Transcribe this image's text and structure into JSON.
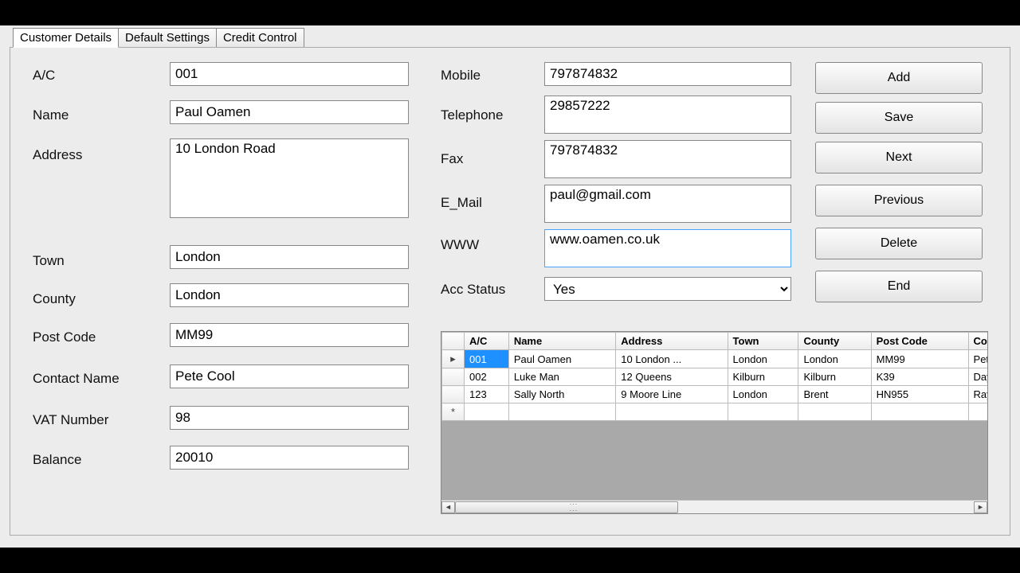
{
  "tabs": {
    "customer_details": "Customer Details",
    "default_settings": "Default Settings",
    "credit_control": "Credit Control"
  },
  "labels": {
    "ac": "A/C",
    "name": "Name",
    "address": "Address",
    "town": "Town",
    "county": "County",
    "post_code": "Post Code",
    "contact_name": "Contact Name",
    "vat_number": "VAT Number",
    "balance": "Balance",
    "mobile": "Mobile",
    "telephone": "Telephone",
    "fax": "Fax",
    "email": "E_Mail",
    "www": "WWW",
    "acc_status": "Acc Status"
  },
  "values": {
    "ac": "001",
    "name": "Paul Oamen",
    "address": "10 London Road",
    "town": "London",
    "county": "London",
    "post_code": "MM99",
    "contact_name": "Pete Cool",
    "vat_number": "98",
    "balance": "20010",
    "mobile": "797874832",
    "telephone": "29857222",
    "fax": "797874832",
    "email": "paul@gmail.com",
    "www": "www.oamen.co.uk",
    "acc_status": "Yes"
  },
  "buttons": {
    "add": "Add",
    "save": "Save",
    "next": "Next",
    "previous": "Previous",
    "delete": "Delete",
    "end": "End"
  },
  "grid": {
    "headers": [
      "A/C",
      "Name",
      "Address",
      "Town",
      "County",
      "Post Code",
      "Contact Name"
    ],
    "rows": [
      [
        "001",
        "Paul Oamen",
        "10 London ...",
        "London",
        "London",
        "MM99",
        "Pete Cool"
      ],
      [
        "002",
        "Luke Man",
        "12 Queens",
        "Kilburn",
        "Kilburn",
        "K39",
        "Day Ton"
      ],
      [
        "123",
        "Sally North",
        "9 Moore Line",
        "London",
        "Brent",
        "HN955",
        "Ray"
      ]
    ],
    "selected_row": 0,
    "selected_col": 0
  }
}
